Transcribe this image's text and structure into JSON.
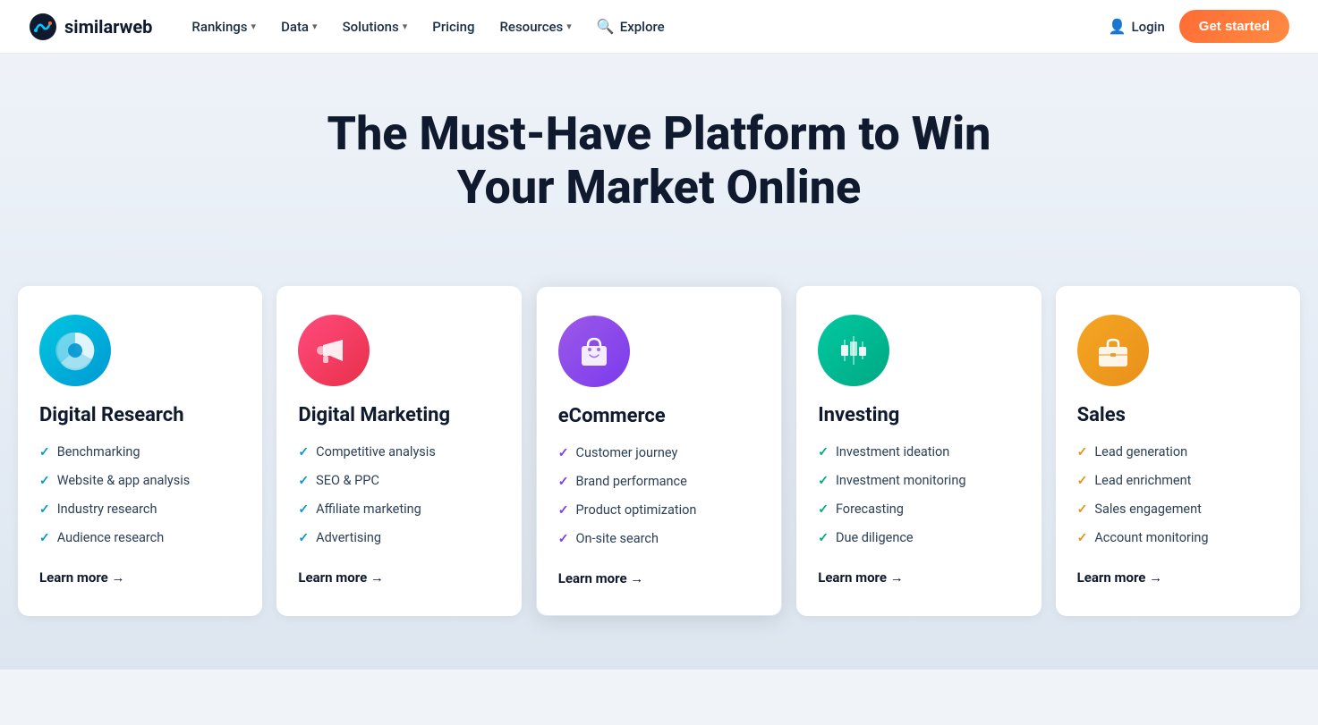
{
  "nav": {
    "logo_text": "similarweb",
    "items": [
      {
        "label": "Rankings",
        "has_dropdown": true
      },
      {
        "label": "Data",
        "has_dropdown": true
      },
      {
        "label": "Solutions",
        "has_dropdown": true
      },
      {
        "label": "Pricing",
        "has_dropdown": false
      },
      {
        "label": "Resources",
        "has_dropdown": true
      }
    ],
    "explore_label": "Explore",
    "login_label": "Login",
    "cta_label": "Get started"
  },
  "hero": {
    "title": "The Must-Have Platform to Win Your Market Online"
  },
  "cards": [
    {
      "id": "digital-research",
      "icon_type": "blue-teal",
      "icon_glyph": "🥧",
      "title": "Digital Research",
      "items": [
        "Benchmarking",
        "Website & app analysis",
        "Industry research",
        "Audience research"
      ],
      "learn_more": "Learn more →",
      "highlighted": false
    },
    {
      "id": "digital-marketing",
      "icon_type": "pink-red",
      "icon_glyph": "📣",
      "title": "Digital Marketing",
      "items": [
        "Competitive analysis",
        "SEO & PPC",
        "Affiliate marketing",
        "Advertising"
      ],
      "learn_more": "Learn more →",
      "highlighted": false
    },
    {
      "id": "ecommerce",
      "icon_type": "purple",
      "icon_glyph": "🛍️",
      "title": "eCommerce",
      "items": [
        "Customer journey",
        "Brand performance",
        "Product optimization",
        "On-site search"
      ],
      "learn_more": "Learn more →",
      "highlighted": true
    },
    {
      "id": "investing",
      "icon_type": "green-teal",
      "icon_glyph": "📊",
      "title": "Investing",
      "items": [
        "Investment ideation",
        "Investment monitoring",
        "Forecasting",
        "Due diligence"
      ],
      "learn_more": "Learn more →",
      "highlighted": false
    },
    {
      "id": "sales",
      "icon_type": "orange-gold",
      "icon_glyph": "💼",
      "title": "Sales",
      "items": [
        "Lead generation",
        "Lead enrichment",
        "Sales engagement",
        "Account monitoring"
      ],
      "learn_more": "Learn more →",
      "highlighted": false
    }
  ],
  "colors": {
    "check_default": "#0099d4",
    "check_ecommerce": "#7c3aed",
    "check_investing": "#00a884",
    "check_sales": "#e8901a",
    "cta_bg": "#ff6b35"
  }
}
